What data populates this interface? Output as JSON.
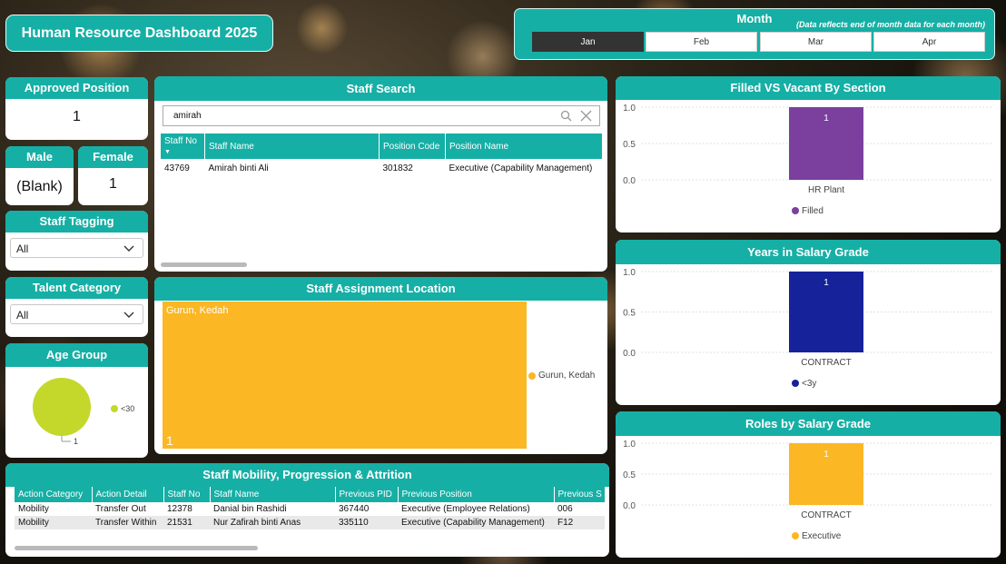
{
  "dashboard": {
    "title": "Human Resource Dashboard 2025"
  },
  "month": {
    "title": "Month",
    "note": "(Data reflects end of month data for each month)",
    "options": [
      "Jan",
      "Feb",
      "Mar",
      "Apr"
    ],
    "selected": "Jan"
  },
  "kpis": {
    "approved": {
      "title": "Approved Position",
      "value": "1"
    },
    "male": {
      "title": "Male",
      "value": "(Blank)"
    },
    "female": {
      "title": "Female",
      "value": "1"
    }
  },
  "filters": {
    "staff_tagging": {
      "title": "Staff Tagging",
      "value": "All"
    },
    "talent_category": {
      "title": "Talent Category",
      "value": "All"
    }
  },
  "age_group": {
    "title": "Age Group",
    "legend": "<30",
    "value_label": "1",
    "color": "#c3d82b"
  },
  "staff_search": {
    "title": "Staff Search",
    "query": "amirah",
    "columns": [
      "Staff No",
      "Staff Name",
      "Position Code",
      "Position Name"
    ],
    "rows": [
      [
        "43769",
        "Amirah binti Ali",
        "301832",
        "Executive (Capability Management)"
      ]
    ]
  },
  "assignment": {
    "title": "Staff Assignment Location",
    "location": "Gurun, Kedah",
    "value": "1",
    "legend": "Gurun, Kedah",
    "color": "#fbb724"
  },
  "mobility": {
    "title": "Staff Mobility, Progression & Attrition",
    "columns": [
      "Action Category",
      "Action Detail",
      "Staff No",
      "Staff Name",
      "Previous PID",
      "Previous Position",
      "Previous S"
    ],
    "rows": [
      [
        "Mobility",
        "Transfer Out",
        "12378",
        "Danial bin Rashidi",
        "367440",
        "Executive (Employee Relations)",
        "006"
      ],
      [
        "Mobility",
        "Transfer Within",
        "21531",
        "Nur Zafirah binti Anas",
        "335110",
        "Executive (Capability Management)",
        "F12"
      ]
    ]
  },
  "charts": {
    "filled_vacant": {
      "title": "Filled VS Vacant By Section",
      "chart_data": {
        "type": "bar",
        "categories": [
          "HR Plant"
        ],
        "series": [
          {
            "name": "Filled",
            "values": [
              1
            ]
          }
        ],
        "ylim": [
          0,
          1
        ],
        "yticks": [
          "1.0",
          "0.5",
          "0.0"
        ],
        "data_label": "1",
        "legend": "Filled",
        "color": "#7b3f9e"
      }
    },
    "years_grade": {
      "title": "Years in Salary Grade",
      "chart_data": {
        "type": "bar",
        "categories": [
          "CONTRACT"
        ],
        "series": [
          {
            "name": "<3y",
            "values": [
              1
            ]
          }
        ],
        "ylim": [
          0,
          1
        ],
        "yticks": [
          "1.0",
          "0.5",
          "0.0"
        ],
        "data_label": "1",
        "legend": "<3y",
        "color": "#15229a"
      }
    },
    "roles_grade": {
      "title": "Roles by Salary Grade",
      "chart_data": {
        "type": "bar",
        "categories": [
          "CONTRACT"
        ],
        "series": [
          {
            "name": "Executive",
            "values": [
              1
            ]
          }
        ],
        "ylim": [
          0,
          1
        ],
        "yticks": [
          "1.0",
          "0.5",
          "0.0"
        ],
        "data_label": "1",
        "legend": "Executive",
        "color": "#fbb724"
      }
    }
  }
}
